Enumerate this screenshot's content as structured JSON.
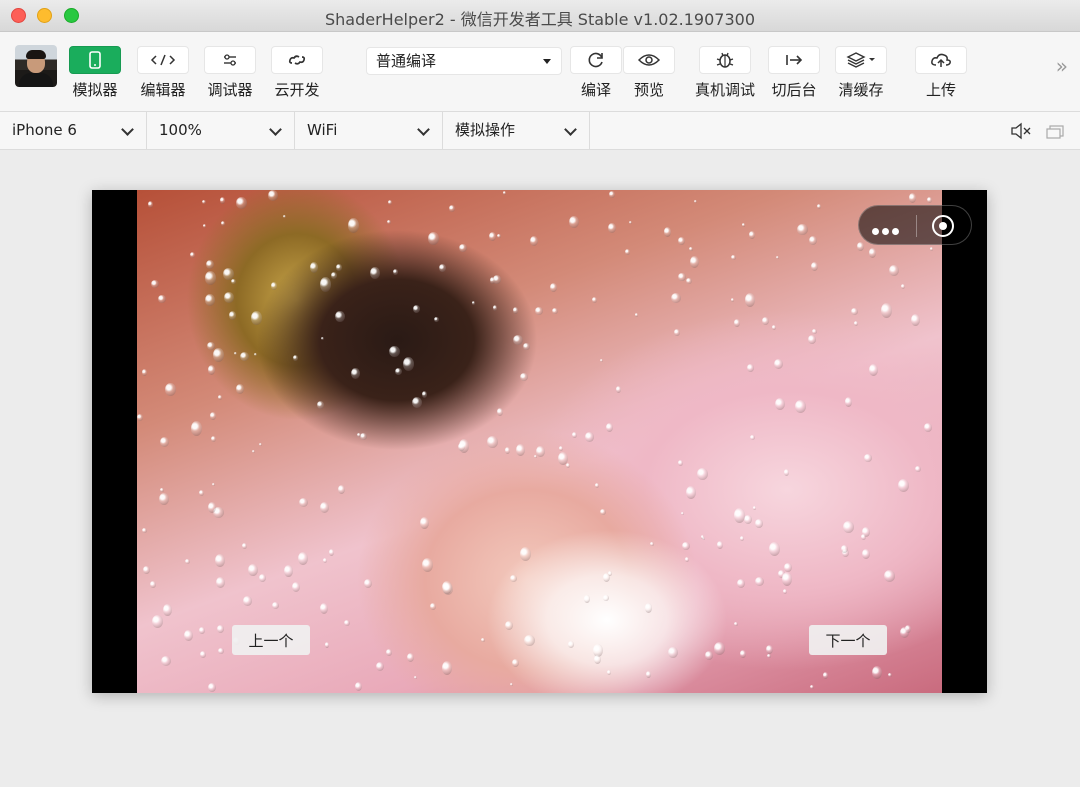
{
  "window": {
    "title": "ShaderHelper2 - 微信开发者工具 Stable v1.02.1907300"
  },
  "toolbar": {
    "simulator": "模拟器",
    "editor": "编辑器",
    "debugger": "调试器",
    "cloud": "云开发",
    "compile_mode": "普通编译",
    "compile": "编译",
    "preview": "预览",
    "remote_debug": "真机调试",
    "background": "切后台",
    "clear_cache": "清缓存",
    "upload": "上传"
  },
  "devbar": {
    "device": "iPhone 6",
    "zoom": "100%",
    "network": "WiFi",
    "operation": "模拟操作"
  },
  "simulator": {
    "prev_label": "上一个",
    "next_label": "下一个"
  },
  "colors": {
    "accent": "#1aad5c"
  },
  "icons": [
    "avatar",
    "phone-icon",
    "code-icon",
    "debug-sliders-icon",
    "cloud-link-icon",
    "refresh-icon",
    "eye-icon",
    "bug-icon",
    "switch-background-icon",
    "layers-icon",
    "cloud-upload-icon",
    "double-chevron-icon",
    "mute-icon",
    "window-icon",
    "more-dots-icon",
    "target-icon"
  ]
}
